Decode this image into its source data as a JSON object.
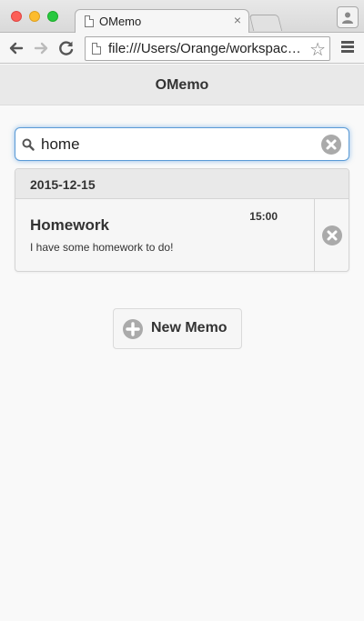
{
  "browser": {
    "tab_title": "OMemo",
    "tab_close": "×",
    "address": "file:///Users/Orange/workspac…",
    "star": "☆"
  },
  "app": {
    "title": "OMemo"
  },
  "search": {
    "value": "home"
  },
  "list": {
    "date": "2015-12-15",
    "items": [
      {
        "time": "15:00",
        "title": "Homework",
        "text": "I have some homework to do!"
      }
    ]
  },
  "actions": {
    "new_memo": "New Memo"
  },
  "colors": {
    "focus_blue": "#5a9ad6",
    "icon_gray": "#aaaaaa"
  }
}
